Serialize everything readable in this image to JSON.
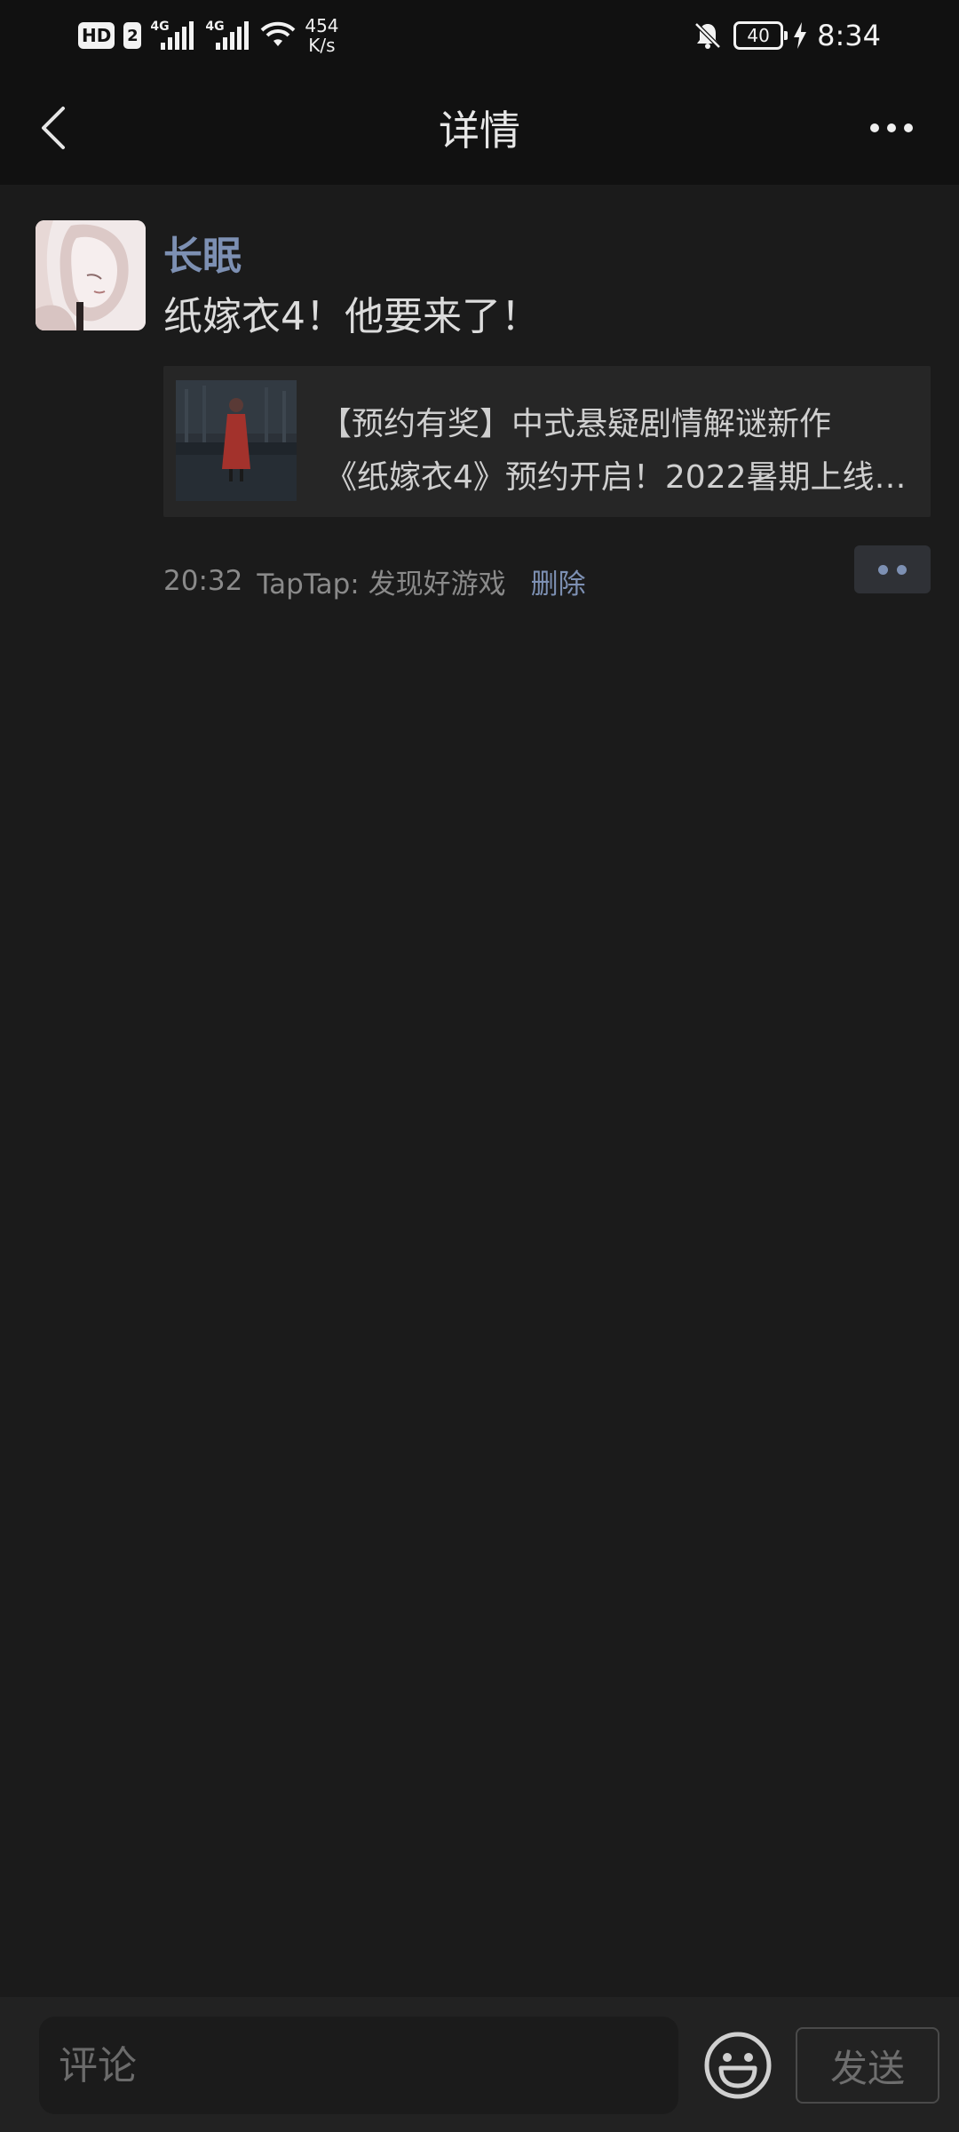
{
  "status_bar": {
    "hd_label": "HD",
    "sim_label": "2",
    "network_1": "4G",
    "network_2": "4G",
    "speed_value": "454",
    "speed_unit": "K/s",
    "battery": "40",
    "time": "8:34"
  },
  "header": {
    "title": "详情"
  },
  "post": {
    "username": "长眠",
    "text": "纸嫁衣4！他要来了！",
    "link_card": {
      "title_line1": "【预约有奖】中式悬疑剧情解谜新作",
      "title_line2": "《纸嫁衣4》预约开启！2022暑期上线…"
    },
    "time": "20:32",
    "source": "TapTap: 发现好游戏",
    "delete_label": "删除"
  },
  "comment_bar": {
    "placeholder": "评论",
    "send_label": "发送"
  },
  "colors": {
    "accent": "#7d90b3",
    "background": "#1b1b1b",
    "bar_background": "#111111"
  }
}
